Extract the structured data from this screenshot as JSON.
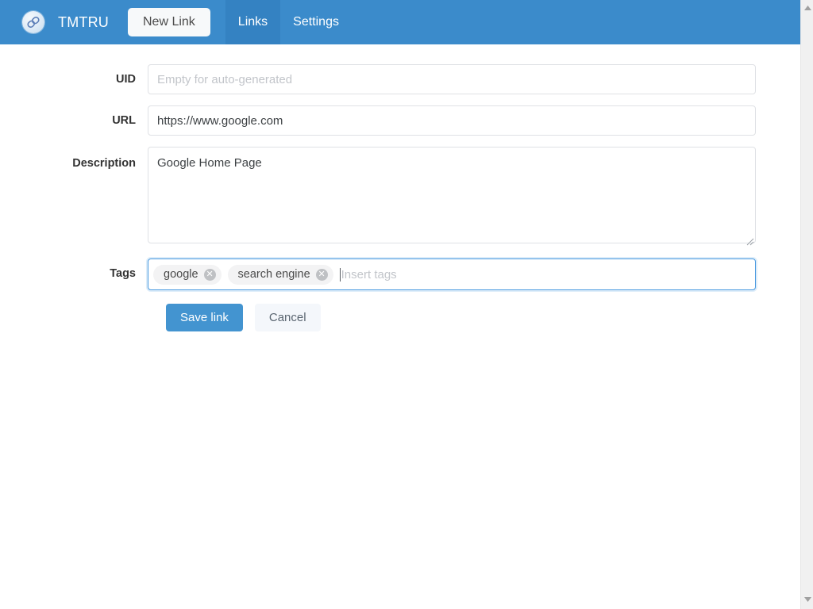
{
  "navbar": {
    "logo_icon": "link-chain-logo-icon",
    "brand": "TMTRU",
    "new_link_label": "New Link",
    "tabs": [
      {
        "label": "Links",
        "active": true
      },
      {
        "label": "Settings",
        "active": false
      }
    ],
    "background_color": "#3b8bcb",
    "active_tab_color": "#3482c2"
  },
  "form": {
    "uid": {
      "label": "UID",
      "value": "",
      "placeholder": "Empty for auto-generated"
    },
    "url": {
      "label": "URL",
      "value": "https://www.google.com",
      "placeholder": ""
    },
    "description": {
      "label": "Description",
      "value": "Google Home Page",
      "placeholder": ""
    },
    "tags": {
      "label": "Tags",
      "items": [
        {
          "name": "google",
          "remove_icon": "close-circle-icon"
        },
        {
          "name": "search engine",
          "remove_icon": "close-circle-icon"
        }
      ],
      "input_value": "",
      "placeholder": "Insert tags",
      "focused": true,
      "focus_border_color": "#4a9ae0"
    },
    "actions": {
      "save_label": "Save link",
      "cancel_label": "Cancel",
      "save_color": "#4394d0",
      "cancel_color": "#f4f7fb"
    }
  },
  "scrollbar": {
    "up_icon": "triangle-up-icon",
    "down_icon": "triangle-down-icon",
    "track_color": "#f0f0f0"
  }
}
